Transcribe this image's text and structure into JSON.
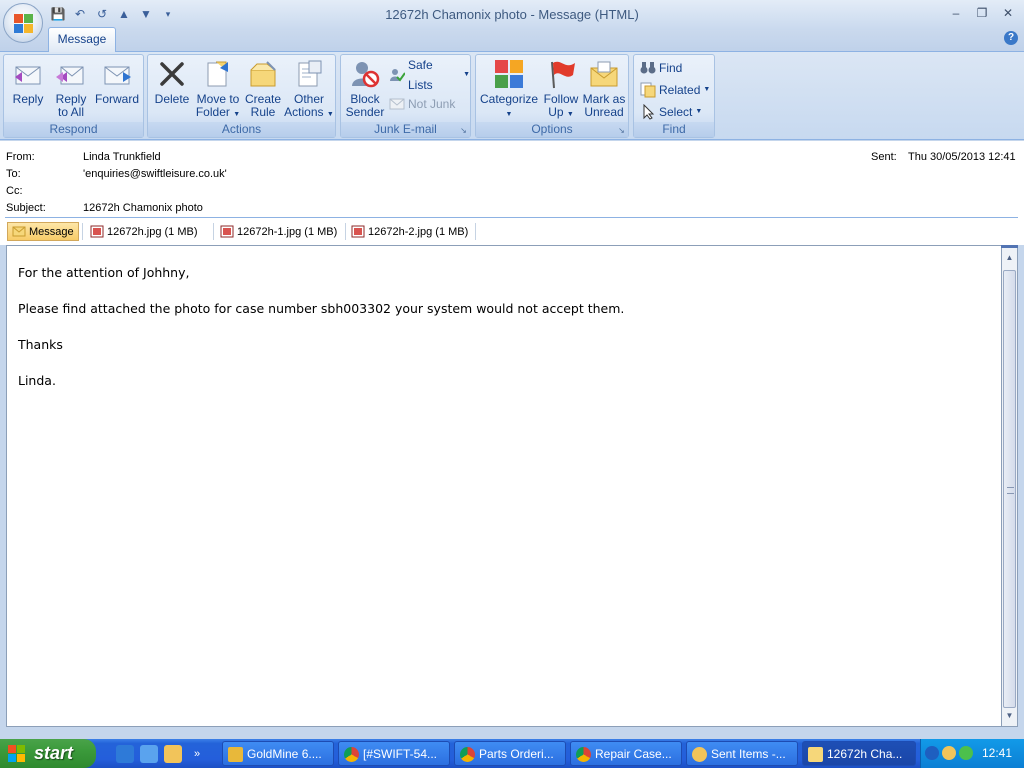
{
  "window": {
    "title": "12672h Chamonix photo - Message (HTML)",
    "controls": [
      "minimize",
      "restore",
      "close"
    ]
  },
  "quick_access": [
    "save-icon",
    "undo-icon",
    "redo-icon",
    "previous-item-icon",
    "next-item-icon",
    "customize-icon"
  ],
  "ribbon": {
    "tab": "Message",
    "groups": {
      "respond": {
        "label": "Respond",
        "reply": "Reply",
        "reply_all_1": "Reply",
        "reply_all_2": "to All",
        "forward": "Forward"
      },
      "actions": {
        "label": "Actions",
        "delete": "Delete",
        "move_1": "Move to",
        "move_2": "Folder",
        "create_1": "Create",
        "create_2": "Rule",
        "other_1": "Other",
        "other_2": "Actions"
      },
      "junk": {
        "label": "Junk E-mail",
        "block_1": "Block",
        "block_2": "Sender",
        "safe_lists": "Safe Lists",
        "not_junk": "Not Junk"
      },
      "options": {
        "label": "Options",
        "categorize": "Categorize",
        "follow_1": "Follow",
        "follow_2": "Up",
        "mark_1": "Mark as",
        "mark_2": "Unread"
      },
      "find": {
        "label": "Find",
        "find": "Find",
        "related": "Related",
        "select": "Select"
      }
    }
  },
  "header": {
    "from_label": "From:",
    "from": "Linda Trunkfield",
    "to_label": "To:",
    "to": "'enquiries@swiftleisure.co.uk'",
    "cc_label": "Cc:",
    "cc": "",
    "subject_label": "Subject:",
    "subject": "12672h Chamonix photo",
    "sent_label": "Sent:",
    "sent": "Thu 30/05/2013 12:41"
  },
  "attachments": {
    "message": "Message",
    "files": [
      "12672h.jpg (1 MB)",
      "12672h-1.jpg (1 MB)",
      "12672h-2.jpg (1 MB)"
    ]
  },
  "body": {
    "line1": "For the attention of Johhny,",
    "line2": "Please find attached the photo for case number sbh003302 your system would not accept them.",
    "line3": "Thanks",
    "line4": "Linda."
  },
  "taskbar": {
    "start": "start",
    "buttons": [
      "GoldMine 6....",
      "[#SWIFT-54...",
      "Parts Orderi...",
      "Repair Case...",
      "Sent Items -...",
      "12672h Cha..."
    ],
    "clock": "12:41"
  }
}
